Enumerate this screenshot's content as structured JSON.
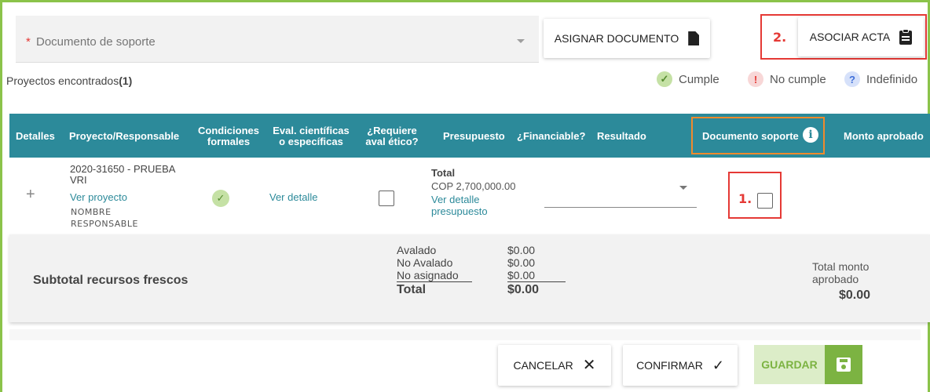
{
  "document_field": {
    "required_mark": "*",
    "placeholder": "Documento de soporte"
  },
  "buttons": {
    "asignar": "ASIGNAR DOCUMENTO",
    "asociar": "ASOCIAR ACTA",
    "cancelar": "CANCELAR",
    "confirmar": "CONFIRMAR",
    "guardar": "GUARDAR"
  },
  "annotations": {
    "step1": "1.",
    "step2": "2."
  },
  "found": {
    "label": "Proyectos encontrados",
    "count": "(1)"
  },
  "legend": {
    "cumple": "Cumple",
    "no_cumple": "No cumple",
    "indefinido": "Indefinido"
  },
  "table": {
    "headers": {
      "detalles": "Detalles",
      "proyecto": "Proyecto/Responsable",
      "condiciones": "Condiciones formales",
      "eval": "Eval. científicas o específicas",
      "aval": "¿Requiere aval ético?",
      "presupuesto": "Presupuesto",
      "financiable": "¿Financiable?",
      "resultado": "Resultado",
      "documento": "Documento soporte",
      "monto": "Monto aprobado"
    },
    "row": {
      "expand": "+",
      "project_code": "2020-31650 - PRUEBA VRI",
      "project_link": "Ver proyecto",
      "responsable": "NOMBRE RESPONSABLE",
      "condiciones_status": "cumple",
      "eval_link": "Ver detalle",
      "aval_checked": false,
      "total_label": "Total",
      "total_value": "COP 2,700,000.00",
      "budget_link": "Ver detalle presupuesto",
      "resultado_value": "",
      "doc_checked": false
    }
  },
  "subtotal": {
    "label": "Subtotal recursos frescos",
    "lines": [
      {
        "label": "Avalado",
        "value": "$0.00"
      },
      {
        "label": "No Avalado",
        "value": "$0.00"
      },
      {
        "label": "No asignado",
        "value": "$0.00"
      },
      {
        "label": "Total",
        "value": "$0.00"
      }
    ],
    "total_monto_label": "Total monto aprobado",
    "total_monto_value": "$0.00"
  },
  "colors": {
    "header_teal": "#2c8a9a",
    "accent_green": "#7cb342",
    "annotation_red": "#e53935",
    "highlight_orange": "#ef8a2c"
  }
}
